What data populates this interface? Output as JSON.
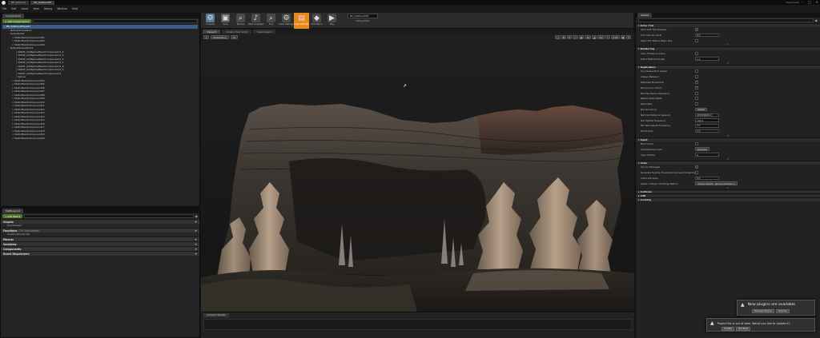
{
  "window": {
    "tabs": [
      "BP_Setpiece",
      "BP_SetPieceE5"
    ],
    "user": "Frank Gozz",
    "controls": [
      "–",
      "□",
      "×"
    ]
  },
  "menu": [
    "File",
    "Edit",
    "Asset",
    "View",
    "Debug",
    "Window",
    "Help"
  ],
  "components": {
    "tab_label": "Components",
    "add_button": "+ Add Component ▾",
    "items": [
      {
        "label": "BP_SetPieceE5(self)",
        "indent": 0,
        "selected": true
      },
      {
        "label": "DefaultSceneRoot",
        "indent": 1
      },
      {
        "label": "SceneRoot2",
        "indent": 1
      },
      {
        "label": "StaticMeshComponent01",
        "indent": 2
      },
      {
        "label": "StaticMeshComponent02",
        "indent": 2
      },
      {
        "label": "StaticMeshComponent03",
        "indent": 2
      },
      {
        "label": "DefaultSceneRoot1",
        "indent": 1
      },
      {
        "label": "NODE_AddSplineMeshComponent-0_4",
        "indent": 3
      },
      {
        "label": "NODE_AddSplineMeshComponent-0_3",
        "indent": 3
      },
      {
        "label": "NODE_AddSplineMeshComponent-0_2",
        "indent": 3
      },
      {
        "label": "NODE_AddSplineMeshComponent-0_1",
        "indent": 3
      },
      {
        "label": "NODE_AddSplineMeshComponent-0_6",
        "indent": 3
      },
      {
        "label": "NODE_AddSplineMeshComponent-0_5",
        "indent": 3
      },
      {
        "label": "NODE_AddSplineMeshComponent-0",
        "indent": 3
      },
      {
        "label": "Spline",
        "indent": 3
      },
      {
        "label": "StaticMeshComponent04",
        "indent": 2
      },
      {
        "label": "StaticMeshComponent05",
        "indent": 2
      },
      {
        "label": "StaticMeshComponent06",
        "indent": 2
      },
      {
        "label": "StaticMeshComponent07",
        "indent": 2
      },
      {
        "label": "StaticMeshComponent08",
        "indent": 2
      },
      {
        "label": "StaticMeshComponent09",
        "indent": 2
      },
      {
        "label": "StaticMeshComponent10",
        "indent": 2
      },
      {
        "label": "StaticMeshComponent11",
        "indent": 2
      },
      {
        "label": "StaticMeshComponent12",
        "indent": 2
      },
      {
        "label": "StaticMeshComponent13",
        "indent": 2
      },
      {
        "label": "StaticMeshComponent14",
        "indent": 2
      },
      {
        "label": "StaticMeshComponent15",
        "indent": 2
      },
      {
        "label": "StaticMeshComponent16",
        "indent": 2
      },
      {
        "label": "StaticMeshComponent17",
        "indent": 2
      },
      {
        "label": "StaticMeshComponent18",
        "indent": 2
      },
      {
        "label": "StaticMeshComponent19",
        "indent": 2
      },
      {
        "label": "StaticMeshComponent20",
        "indent": 2
      }
    ]
  },
  "my_blueprint": {
    "tab_label": "MyBlueprint",
    "add_button": "+ Add New ▾",
    "sections": [
      {
        "label": "Graphs",
        "items": [
          "EventGraph"
        ]
      },
      {
        "label": "Functions",
        "note": "(26 Overridable)",
        "items": [
          "ConstructionScript"
        ]
      },
      {
        "label": "Macros",
        "items": []
      },
      {
        "label": "Variables",
        "items": []
      },
      {
        "label": "Components",
        "items": []
      },
      {
        "label": "Event Dispatchers",
        "items": []
      }
    ]
  },
  "toolbar": {
    "buttons": [
      {
        "label": "Compile",
        "icon": "⚙",
        "color": "#5f7c95",
        "highlight": false
      },
      {
        "label": "Save",
        "icon": "▣",
        "color": "#5a5a5a",
        "highlight": false
      },
      {
        "label": "Browse",
        "icon": "⌕",
        "color": "#4a4a4a",
        "highlight": false
      },
      {
        "label": "Hide Unrelated",
        "icon": "♪",
        "color": "#4a4a4a",
        "highlight": false
      },
      {
        "label": "Find",
        "icon": "⌕",
        "color": "#4a4a4a",
        "highlight": false
      },
      {
        "label": "Class Settings",
        "icon": "⚙",
        "color": "#4a4a4a",
        "highlight": false
      },
      {
        "label": "Class Defaults",
        "icon": "▤",
        "color": "#e8881f",
        "highlight": true
      },
      {
        "label": "Simulation",
        "icon": "◆",
        "color": "#4a4a4a",
        "highlight": false
      },
      {
        "label": "Play",
        "icon": "▶",
        "color": "#4a4a4a",
        "highlight": false
      }
    ],
    "debug_selection": "BP_SetPieceE5▾",
    "debug_label": "Debug Filter"
  },
  "editor_tabs": [
    {
      "label": "Viewport",
      "active": true
    },
    {
      "label": "Construction Script",
      "active": false
    },
    {
      "label": "Event Graph",
      "active": false
    }
  ],
  "viewport": {
    "perspective": "Perspective",
    "lit": "Lit",
    "right_buttons": [
      "◻",
      "✥",
      "⟳",
      "⤢",
      "▦",
      "10",
      "◢",
      "10°",
      "⤡",
      "0.25",
      "▣",
      "4"
    ]
  },
  "compiler": {
    "tab_label": "Compiler Results"
  },
  "details": {
    "tab_label": "Details",
    "sections": [
      {
        "title": "Actor Tick",
        "rows": [
          {
            "label": "Start with Tick Enabled",
            "type": "check",
            "value": true
          },
          {
            "label": "Tick Interval (secs)",
            "type": "num",
            "value": "0.0"
          },
          {
            "label": "Allow Tick Before Begin Play",
            "type": "check",
            "value": false
          }
        ]
      },
      {
        "title": "Rendering",
        "rows": [
          {
            "label": "Actor Hidden In Game",
            "type": "check",
            "value": false
          },
          {
            "label": "Editor Billboard Scale",
            "type": "num",
            "value": "1.0"
          }
        ]
      },
      {
        "title": "Replication",
        "rows": [
          {
            "label": "Only Relevant to Owner",
            "type": "check",
            "value": false
          },
          {
            "label": "Always Relevant",
            "type": "check",
            "value": false
          },
          {
            "label": "Replicate Movement",
            "type": "check",
            "value": true
          },
          {
            "label": "Net Load on Client",
            "type": "check",
            "value": true
          },
          {
            "label": "Net Use Owner Relevancy",
            "type": "check",
            "value": false
          },
          {
            "label": "Replay Rewindable",
            "type": "check",
            "value": false
          },
          {
            "label": "Replicates",
            "type": "check",
            "value": false
          },
          {
            "label": "Net Dormancy",
            "type": "drop",
            "value": "Awake"
          },
          {
            "label": "Net Cull Distance Squared",
            "type": "num",
            "value": "225000000.0"
          },
          {
            "label": "Net Update Frequency",
            "type": "num",
            "value": "100.0"
          },
          {
            "label": "Min Net Update Frequency",
            "type": "num",
            "value": "2.0"
          },
          {
            "label": "Net Priority",
            "type": "num",
            "value": "1.0"
          }
        ]
      },
      {
        "title": "Input",
        "rows": [
          {
            "label": "Block Input",
            "type": "check",
            "value": false
          },
          {
            "label": "Auto Receive Input",
            "type": "drop",
            "value": "Disabled"
          },
          {
            "label": "Input Priority",
            "type": "num",
            "value": "0"
          }
        ]
      },
      {
        "title": "Actor",
        "rows": [
          {
            "label": "Can be Damaged",
            "type": "check",
            "value": true
          },
          {
            "label": "Generate Overlap Events During Level Streaming",
            "type": "check",
            "value": false
          },
          {
            "label": "Initial Life Span",
            "type": "num",
            "value": "0.0"
          },
          {
            "label": "Spawn Collision Handling Method",
            "type": "drop",
            "value": "Always Spawn, Ignore Collisions ▾"
          }
        ]
      },
      {
        "title": "Collision",
        "rows": []
      },
      {
        "title": "LOD",
        "rows": []
      },
      {
        "title": "Cooking",
        "rows": []
      }
    ]
  },
  "notifications": {
    "plugins": {
      "text": "New plugins are available",
      "button1": "Manage Plugins",
      "button2": "Dismiss"
    },
    "project": {
      "text": "Project file is out of date. Would you like to update it?",
      "button1": "Update",
      "button2": "Not Now"
    }
  }
}
